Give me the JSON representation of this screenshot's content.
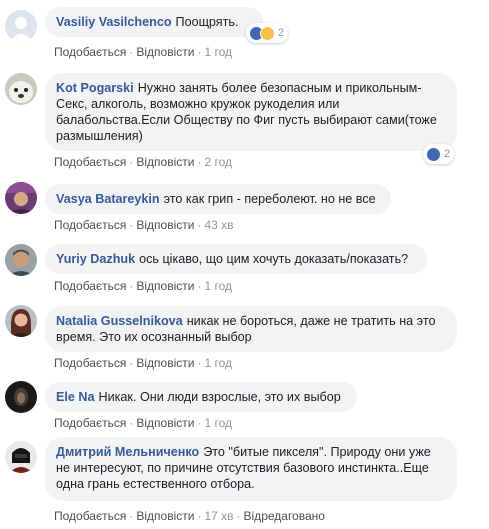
{
  "comments": [
    {
      "author": "Vasiliy Vasilchenco",
      "text": "Поощрять.",
      "like_label": "Подобається",
      "reply_label": "Відповісти",
      "time": "1 год",
      "reaction_count": "2",
      "avatar": "default-avatar"
    },
    {
      "author": "Kot Pogarski",
      "text": "Нужно занять более безопасным и прикольным- Секс, алкоголь, возможно кружок рукоделия или балабольства.Если Обществу по Фиг пусть выбирают сами(тоже размышления)",
      "like_label": "Подобається",
      "reply_label": "Відповісти",
      "time": "2 год",
      "reaction_count": "2",
      "avatar": "white-animal-photo"
    },
    {
      "author": "Vasya Batareykin",
      "text": "это как грип - переболеют. но не все",
      "like_label": "Подобається",
      "reply_label": "Відповісти",
      "time": "43 хв",
      "avatar": "person-photo"
    },
    {
      "author": "Yuriy Dazhuk",
      "text": "ось цікаво, що цим хочуть доказать/показать?",
      "like_label": "Подобається",
      "reply_label": "Відповісти",
      "time": "1 год",
      "avatar": "person-photo"
    },
    {
      "author": "Natalia Gusselnikova",
      "text": "никак не бороться, даже не тратить на это время. Это их осознанный выбор",
      "like_label": "Подобається",
      "reply_label": "Відповісти",
      "time": "1 год",
      "avatar": "person-photo"
    },
    {
      "author": "Ele Na",
      "text": "Никак. Они люди взрослые, это их выбор",
      "like_label": "Подобається",
      "reply_label": "Відповісти",
      "time": "1 год",
      "avatar": "dark-photo"
    },
    {
      "author": "Дмитрий Мельниченко",
      "text": "Это \"битые пикселя\". Природу они уже не интересуют, по причине отсутствия базового инстинкта..Еще одна грань естественного отбора.",
      "like_label": "Подобається",
      "reply_label": "Відповісти",
      "time": "17 хв",
      "edited_label": "Відредаговано",
      "avatar": "person-photo"
    }
  ],
  "colors": {
    "author": "#385898",
    "bubble": "#f2f3f5",
    "meta": "#90949c",
    "like": "#4267b2"
  }
}
